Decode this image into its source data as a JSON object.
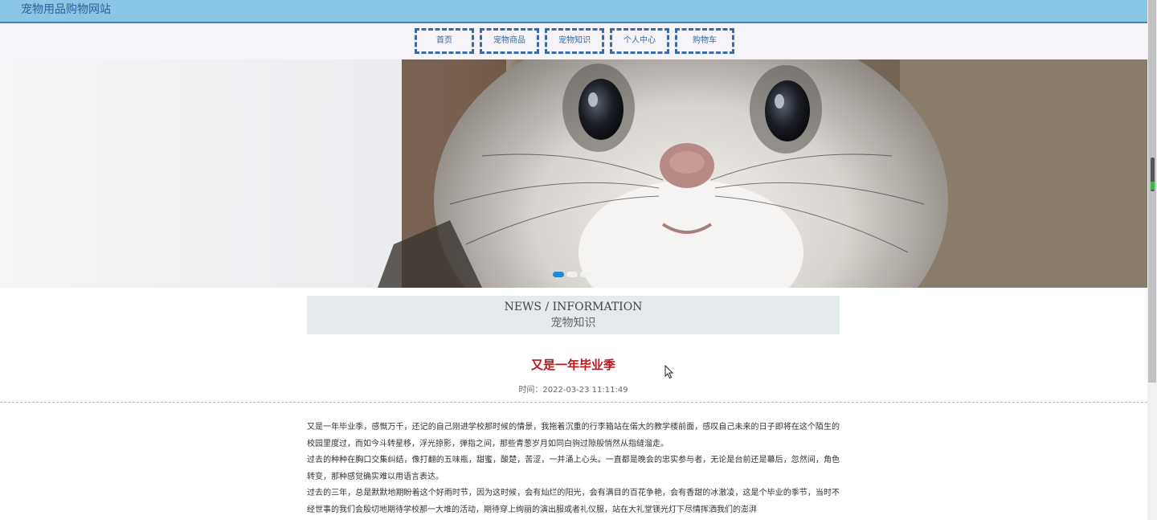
{
  "header": {
    "site_title": "宠物用品购物网站"
  },
  "nav": {
    "items": [
      {
        "label": "首页"
      },
      {
        "label": "宠物商品"
      },
      {
        "label": "宠物知识"
      },
      {
        "label": "个人中心"
      },
      {
        "label": "购物车"
      }
    ]
  },
  "banner": {
    "image": "flying-squirrel-photo",
    "slides_total": 3,
    "active_slide": 1
  },
  "section": {
    "title_en": "NEWS / INFORMATION",
    "title_cn": "宠物知识"
  },
  "article": {
    "title": "又是一年毕业季",
    "time": "时间：2022-03-23 11:11:49",
    "paragraphs": [
      "又是一年毕业季，感慨万千，还记的自己刚进学校那时候的情景，我拖着沉重的行李箱站在偌大的教学楼前面，感叹自己未来的日子即将在这个陌生的校园里度过，而如今斗转星移，浮光掠影，弹指之间，那些青葱岁月如同白驹过隙般悄然从指缝溜走。",
      "过去的种种在胸口交集纠结，像打翻的五味瓶，甜蜜，酸楚，苦涩，一并涌上心头。一直都是晚会的忠实参与者，无论是台前还是幕后，忽然间，角色转变，那种感觉确实难以用语言表达。",
      "过去的三年，总是默默地期盼着这个好雨时节，因为这时候，会有灿烂的阳光，会有满目的百花争艳，会有香甜的冰激凌，这是个毕业的季节，当时不经世事的我们会殷切地期待学校那一大堆的活动，期待穿上绚丽的演出服或者礼仪服，站在大礼堂镁光灯下尽情挥洒我们的澎湃"
    ]
  },
  "colors": {
    "header_bg": "#8ac6e6",
    "title_text": "#2f5f9a",
    "nav_border": "#3a6aa5",
    "article_title": "#c0151b",
    "active_dot": "#1e88d0"
  }
}
